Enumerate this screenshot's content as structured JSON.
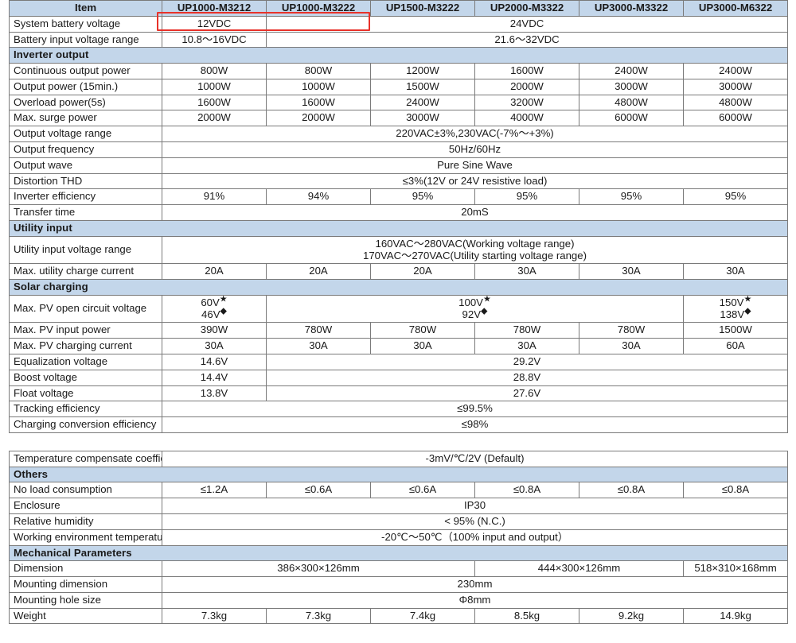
{
  "document": {
    "type": "product-specification-table",
    "highlight_color": "#e8322a",
    "section_header_color": "#c3d6ea"
  },
  "columns": {
    "item_header": "Item",
    "models": [
      "UP1000-M3212",
      "UP1000-M3222",
      "UP1500-M3222",
      "UP2000-M3322",
      "UP3000-M3322",
      "UP3000-M6322"
    ]
  },
  "table1": {
    "battery": {
      "system_battery_voltage": {
        "label": "System battery voltage",
        "col1": "12VDC",
        "cols2to6": "24VDC"
      },
      "battery_input_voltage_range": {
        "label": "Battery input voltage range",
        "col1": "10.8～16VDC",
        "cols2to6": "21.6～32VDC"
      }
    },
    "inverter_output": {
      "section": "Inverter output",
      "continuous_output_power": {
        "label": "Continuous output power",
        "values": [
          "800W",
          "800W",
          "1200W",
          "1600W",
          "2400W",
          "2400W"
        ]
      },
      "output_power_15min": {
        "label": "Output power (15min.)",
        "values": [
          "1000W",
          "1000W",
          "1500W",
          "2000W",
          "3000W",
          "3000W"
        ]
      },
      "overload_power_5s": {
        "label": "Overload power(5s)",
        "values": [
          "1600W",
          "1600W",
          "2400W",
          "3200W",
          "4800W",
          "4800W"
        ]
      },
      "max_surge_power": {
        "label": "Max. surge power",
        "values": [
          "2000W",
          "2000W",
          "3000W",
          "4000W",
          "6000W",
          "6000W"
        ]
      },
      "output_voltage_range": {
        "label": "Output voltage range",
        "value": "220VAC±3%,230VAC(-7%～+3%)"
      },
      "output_frequency": {
        "label": "Output frequency",
        "value": "50Hz/60Hz"
      },
      "output_wave": {
        "label": "Output wave",
        "value": "Pure Sine Wave"
      },
      "distortion_thd": {
        "label": "Distortion THD",
        "value": "≤3%(12V or 24V resistive load)"
      },
      "inverter_efficiency": {
        "label": "Inverter efficiency",
        "values": [
          "91%",
          "94%",
          "95%",
          "95%",
          "95%",
          "95%"
        ]
      },
      "transfer_time": {
        "label": "Transfer time",
        "value": "20mS"
      }
    },
    "utility_input": {
      "section": "Utility input",
      "utility_input_voltage_range": {
        "label": "Utility input voltage range",
        "line1": "160VAC～280VAC(Working voltage range)",
        "line2": "170VAC～270VAC(Utility starting voltage range)"
      },
      "max_utility_charge_current": {
        "label": "Max. utility charge current",
        "values": [
          "20A",
          "20A",
          "20A",
          "30A",
          "30A",
          "30A"
        ]
      }
    },
    "solar_charging": {
      "section": "Solar charging",
      "max_pv_open_circuit_voltage": {
        "label": "Max. PV open circuit voltage",
        "col1_line1": "60V",
        "col1_line2": "46V",
        "cols2to5_line1": "100V",
        "cols2to5_line2": "92V",
        "col6_line1": "150V",
        "col6_line2": "138V",
        "marker_star": "★",
        "marker_diamond": "◆"
      },
      "max_pv_input_power": {
        "label": "Max. PV input power",
        "values": [
          "390W",
          "780W",
          "780W",
          "780W",
          "780W",
          "1500W"
        ]
      },
      "max_pv_charging_current": {
        "label": "Max. PV charging current",
        "values": [
          "30A",
          "30A",
          "30A",
          "30A",
          "30A",
          "60A"
        ]
      },
      "equalization_voltage": {
        "label": "Equalization voltage",
        "col1": "14.6V",
        "cols2to6": "29.2V"
      },
      "boost_voltage": {
        "label": "Boost voltage",
        "col1": "14.4V",
        "cols2to6": "28.8V"
      },
      "float_voltage": {
        "label": "Float voltage",
        "col1": "13.8V",
        "cols2to6": "27.6V"
      },
      "tracking_efficiency": {
        "label": "Tracking efficiency",
        "value": "≤99.5%"
      },
      "charging_conversion_efficiency": {
        "label": "Charging conversion efficiency",
        "value": "≤98%"
      }
    }
  },
  "table2": {
    "temperature_compensate_coefficient": {
      "label": "Temperature compensate coefficient",
      "value": "-3mV/℃/2V (Default)"
    },
    "others": {
      "section": "Others",
      "no_load_consumption": {
        "label": "No load consumption",
        "values": [
          "≤1.2A",
          "≤0.6A",
          "≤0.6A",
          "≤0.8A",
          "≤0.8A",
          "≤0.8A"
        ]
      },
      "enclosure": {
        "label": "Enclosure",
        "value": "IP30"
      },
      "relative_humidity": {
        "label": "Relative humidity",
        "value": "< 95% (N.C.)"
      },
      "working_environment_temperature": {
        "label": "Working environment temperature",
        "value": "-20℃～50℃（100% input and output）"
      }
    },
    "mechanical_parameters": {
      "section": "Mechanical Parameters",
      "dimension": {
        "label": "Dimension",
        "group1": "386×300×126mm",
        "group2": "444×300×126mm",
        "group3": "518×310×168mm"
      },
      "mounting_dimension": {
        "label": "Mounting dimension",
        "value": "230mm"
      },
      "mounting_hole_size": {
        "label": "Mounting hole size",
        "value": "Φ8mm"
      },
      "weight": {
        "label": "Weight",
        "values": [
          "7.3kg",
          "7.3kg",
          "7.4kg",
          "8.5kg",
          "9.2kg",
          "14.9kg"
        ]
      }
    }
  }
}
